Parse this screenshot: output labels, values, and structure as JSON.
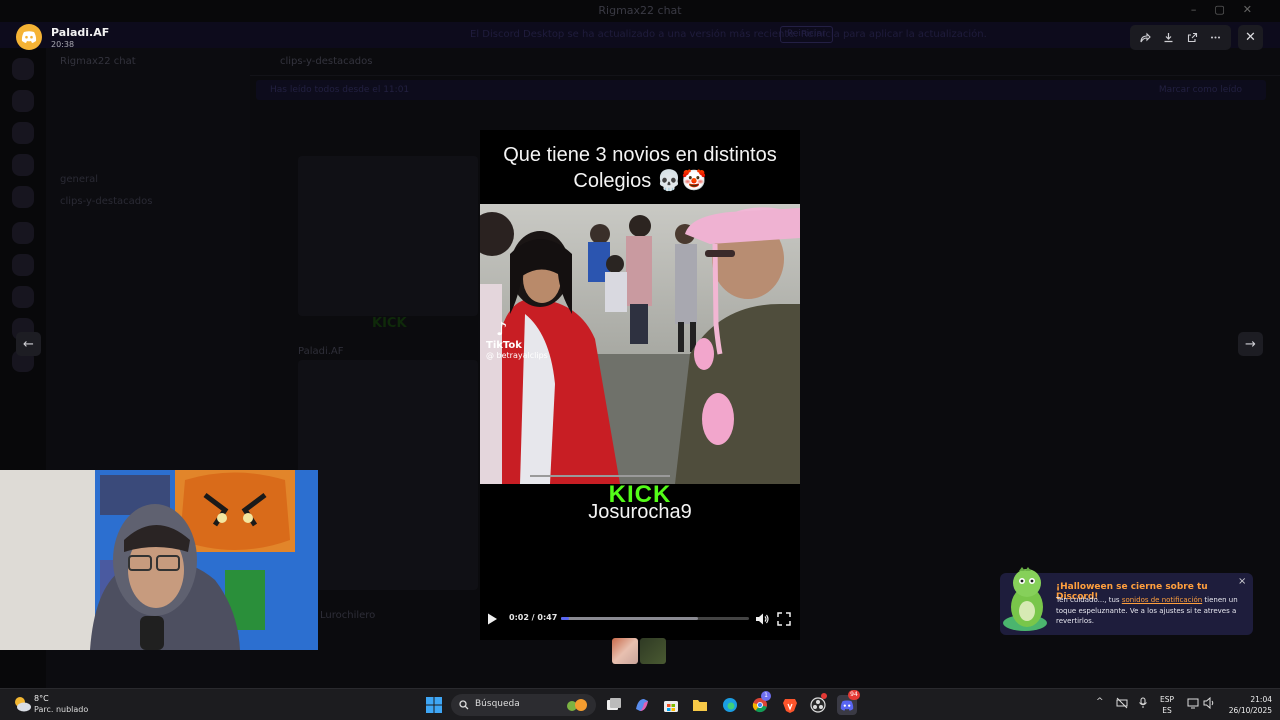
{
  "background_app": {
    "window_title": "Rigmax22 chat",
    "banner_text": "El Discord Desktop se ha actualizado a una versión más reciente. Reinicia para aplicar la actualización.",
    "banner_button": "Reiniciar",
    "server_name": "Rigmax22 chat",
    "channels": [
      "general",
      "clips-y-destacados"
    ],
    "channel_header": "clips-y-destacados",
    "strip_text": "Has leído todos desde el 11:01",
    "strip_right": "Marcar como leído",
    "message_author_1": "Paladi.AF",
    "message_author_2": "Lurochilero"
  },
  "viewer": {
    "user_name": "Paladi.AF",
    "time": "20:38",
    "toolbar_icons": [
      "forward-icon",
      "download-icon",
      "open-external-icon",
      "more-icon"
    ],
    "close_label": "✕",
    "prev_label": "←",
    "next_label": "→"
  },
  "video": {
    "caption_line1": "Que tiene 3 novios en distintos",
    "caption_line2": "Colegios 💀🤡",
    "tiktok_name": "TikTok",
    "tiktok_handle": "@ betrayalclips",
    "kick_logo": "KICK",
    "kick_user": "Josurocha9",
    "time_display": "0:02 / 0:47",
    "progress_fraction": 0.04,
    "buffered_fraction": 0.73
  },
  "notification": {
    "title": "¡Halloween se cierne sobre tu Discord!",
    "body_before": "Ten cuidado..., tus ",
    "body_link": "sonidos de notificación",
    "body_after": " tienen un toque espeluznante. Ve a los ajustes si te atreves a revertirlos.",
    "close_label": "×"
  },
  "taskbar": {
    "temperature": "8°C",
    "weather": "Parc. nublado",
    "search_label": "Búsqueda",
    "lang_top": "ESP",
    "lang_bottom": "ES",
    "time": "21:04",
    "date": "26/10/2025",
    "discord_badge": "94",
    "chrome_badge": "1"
  },
  "colors": {
    "accent": "#5865f2",
    "kick_green": "#53fc18",
    "notif_orange": "#ff9f3d",
    "avatar_yellow": "#f5b335"
  }
}
